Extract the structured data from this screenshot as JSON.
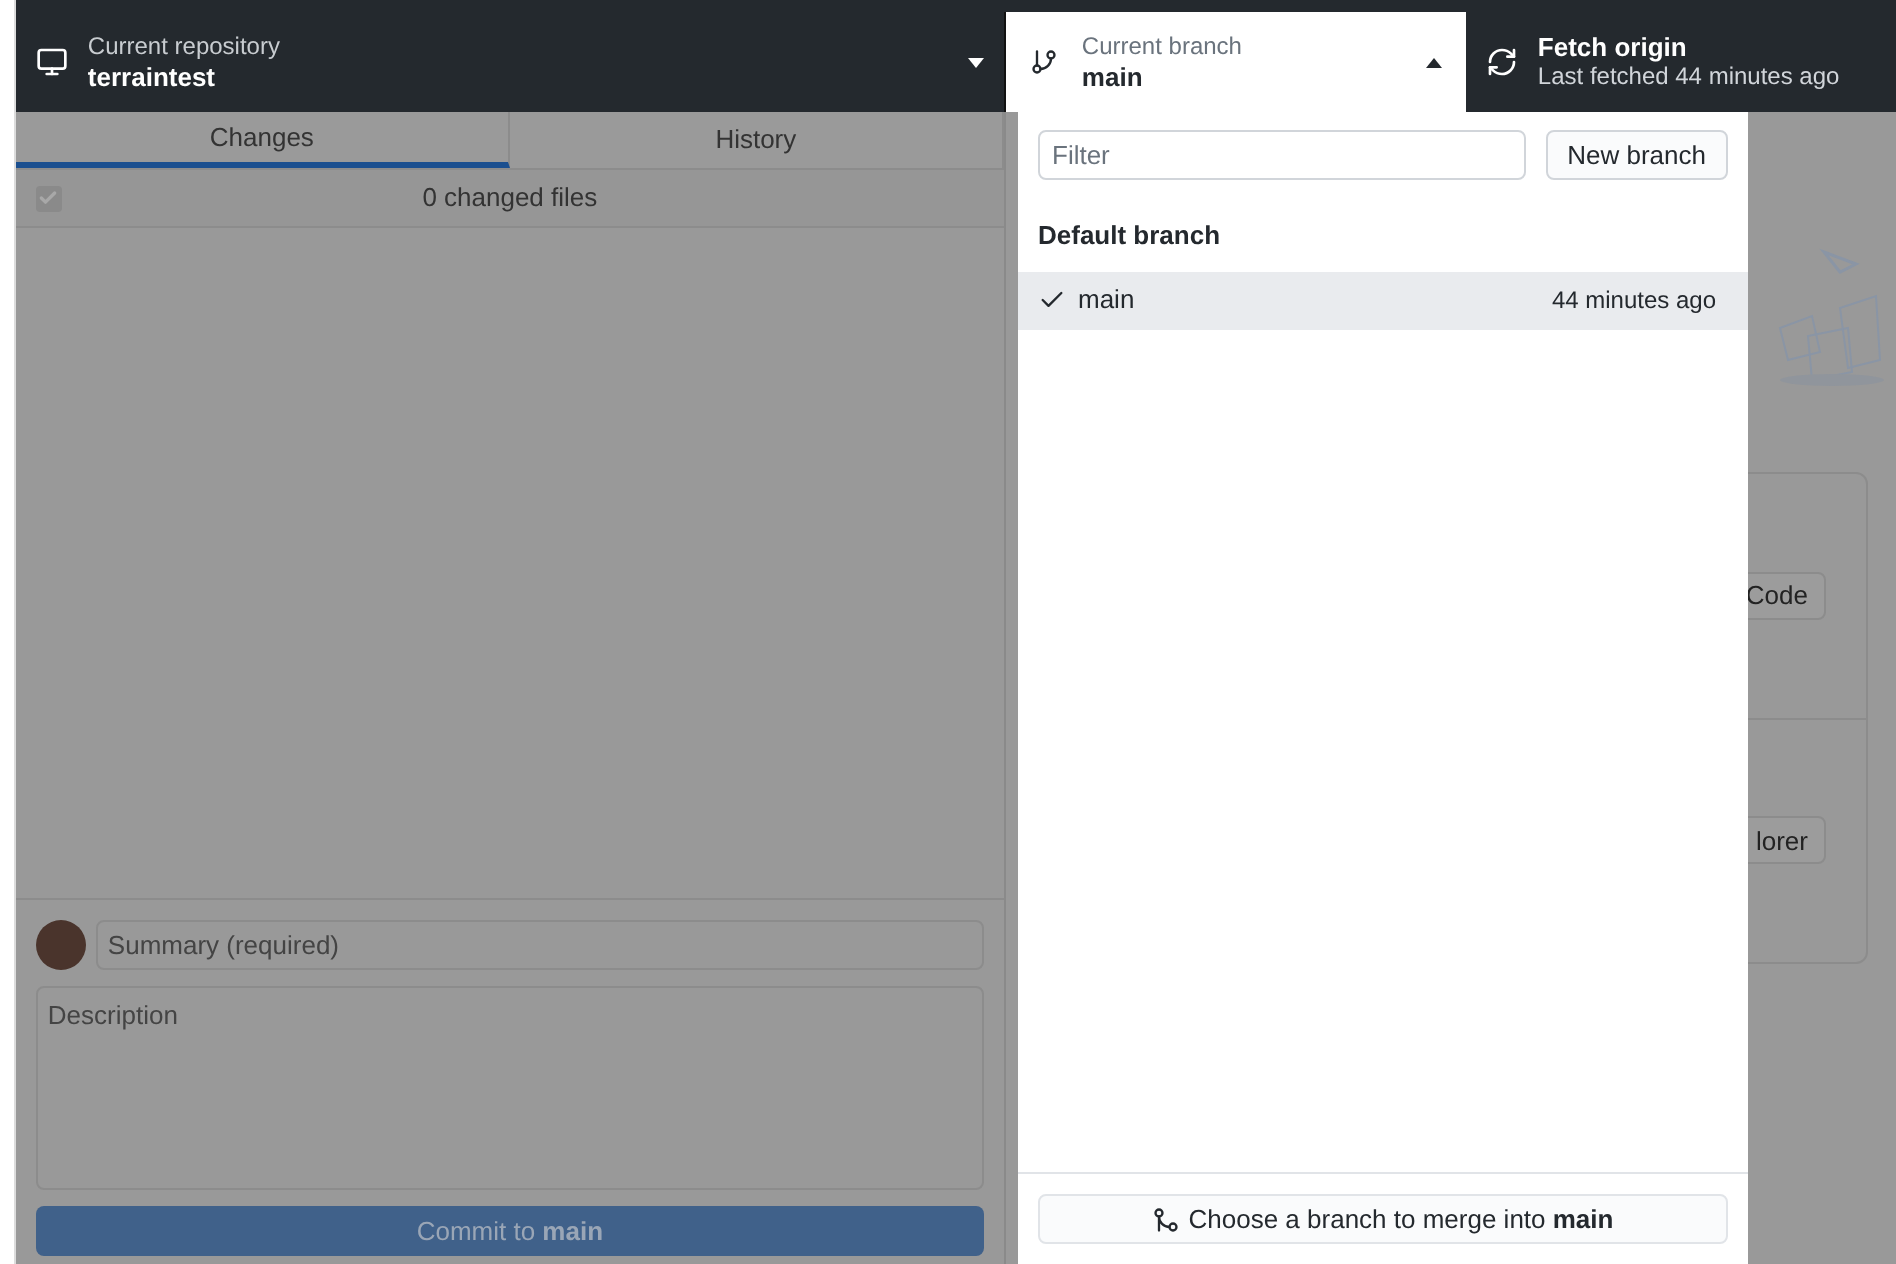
{
  "repository": {
    "label": "Current repository",
    "name": "terraintest"
  },
  "branch": {
    "label": "Current branch",
    "name": "main",
    "expanded": true
  },
  "fetch": {
    "title": "Fetch origin",
    "subtitle": "Last fetched 44 minutes ago"
  },
  "tabs": [
    {
      "label": "Changes",
      "selected": true
    },
    {
      "label": "History",
      "selected": false
    }
  ],
  "changes": {
    "summary": "0 changed files",
    "all_checked": true
  },
  "commit": {
    "summary_placeholder": "Summary (required)",
    "description_placeholder": "Description",
    "button": "Commit to **main**"
  },
  "branch_menu": {
    "filter_placeholder": "Filter",
    "new_button": "New branch",
    "group": "Default branch",
    "branches": [
      {
        "name": "main",
        "time": "44 minutes ago",
        "selected": true
      }
    ],
    "merge_button": "Choose a branch to merge into **main**"
  },
  "background_card": {
    "buttons": [
      "Code",
      "lorer"
    ]
  }
}
